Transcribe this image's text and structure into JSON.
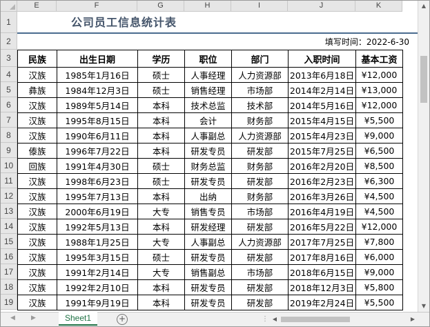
{
  "columns": [
    "E",
    "F",
    "G",
    "H",
    "I",
    "J",
    "K"
  ],
  "rows": [
    "1",
    "2",
    "3",
    "4",
    "5",
    "6",
    "7",
    "8",
    "9",
    "10",
    "11",
    "12",
    "13",
    "14",
    "15",
    "16",
    "17",
    "18",
    "19"
  ],
  "title": "公司员工信息统计表",
  "fill_date": "填写时间：2022-6-30",
  "table": {
    "headers": [
      "民族",
      "出生日期",
      "学历",
      "职位",
      "部门",
      "入职时间",
      "基本工资"
    ],
    "rows": [
      [
        "汉族",
        "1985年1月16日",
        "硕士",
        "人事经理",
        "人力资源部",
        "2013年6月18日",
        "¥12,000"
      ],
      [
        "彝族",
        "1984年12月3日",
        "硕士",
        "销售经理",
        "市场部",
        "2014年2月14日",
        "¥13,000"
      ],
      [
        "汉族",
        "1989年5月14日",
        "本科",
        "技术总监",
        "技术部",
        "2014年5月16日",
        "¥12,000"
      ],
      [
        "汉族",
        "1995年8月15日",
        "本科",
        "会计",
        "财务部",
        "2015年4月15日",
        "¥5,500"
      ],
      [
        "汉族",
        "1990年6月11日",
        "本科",
        "人事副总",
        "人力资源部",
        "2015年4月23日",
        "¥9,000"
      ],
      [
        "傣族",
        "1996年7月22日",
        "本科",
        "研发专员",
        "研发部",
        "2015年7月25日",
        "¥6,500"
      ],
      [
        "回族",
        "1991年4月30日",
        "硕士",
        "财务总监",
        "财务部",
        "2016年2月20日",
        "¥8,500"
      ],
      [
        "汉族",
        "1998年6月23日",
        "硕士",
        "研发专员",
        "研发部",
        "2016年2月23日",
        "¥6,300"
      ],
      [
        "汉族",
        "1995年7月13日",
        "本科",
        "出纳",
        "财务部",
        "2016年3月26日",
        "¥4,500"
      ],
      [
        "汉族",
        "2000年6月19日",
        "大专",
        "销售专员",
        "市场部",
        "2016年4月19日",
        "¥4,500"
      ],
      [
        "汉族",
        "1992年5月13日",
        "本科",
        "研发经理",
        "研发部",
        "2016年5月22日",
        "¥12,000"
      ],
      [
        "汉族",
        "1988年1月25日",
        "大专",
        "人事副总",
        "人力资源部",
        "2017年7月25日",
        "¥7,800"
      ],
      [
        "汉族",
        "1995年3月15日",
        "硕士",
        "研发专员",
        "研发部",
        "2017年8月16日",
        "¥6,000"
      ],
      [
        "汉族",
        "1991年2月14日",
        "大专",
        "销售副总",
        "市场部",
        "2018年6月15日",
        "¥9,000"
      ],
      [
        "汉族",
        "1992年2月10日",
        "本科",
        "研发专员",
        "研发部",
        "2018年12月3日",
        "¥5,800"
      ],
      [
        "汉族",
        "1991年9月19日",
        "本科",
        "研发专员",
        "研发部",
        "2019年2月24日",
        "¥5,500"
      ]
    ]
  },
  "sheet_tab": "Sheet1",
  "add_sheet_symbol": "+",
  "colors": {
    "title": "#44546a",
    "rule": "#4a6b8f",
    "tab_accent": "#217346"
  }
}
